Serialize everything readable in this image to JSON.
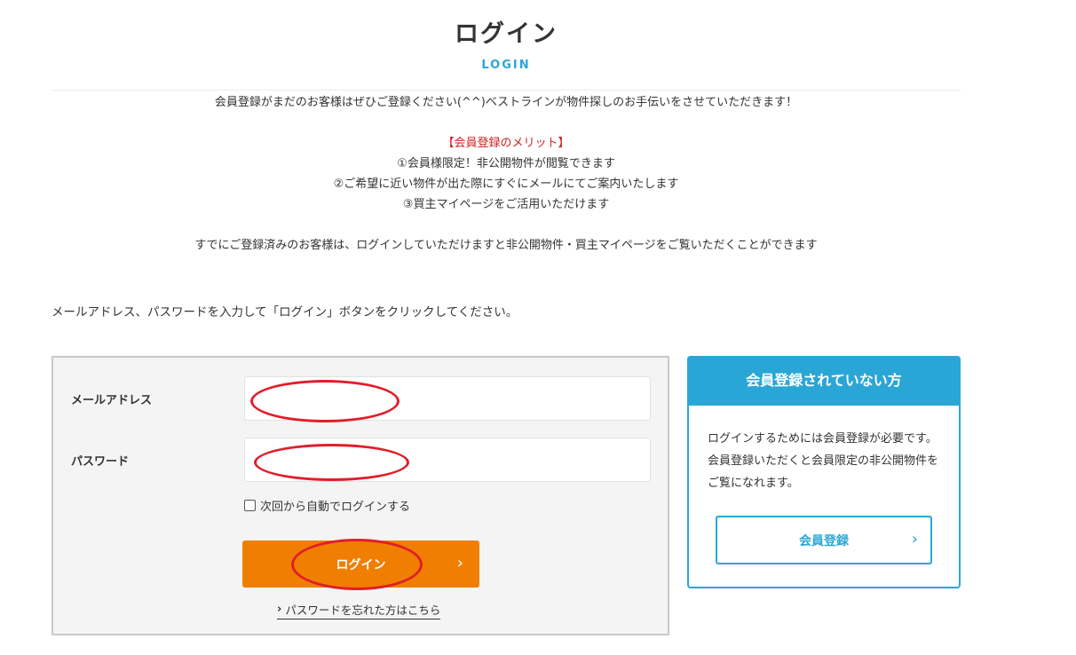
{
  "header": {
    "title": "ログイン",
    "subtitle": "LOGIN"
  },
  "intro": {
    "line1": "会員登録がまだのお客様はぜひご登録ください(^^)ベストラインが物件探しのお手伝いをさせていただきます！",
    "merit_heading": "【会員登録のメリット】",
    "merit_1": "①会員様限定！非公開物件が閲覧できます",
    "merit_2": "②ご希望に近い物件が出た際にすぐにメールにてご案内いたします",
    "merit_3": "③買主マイページをご活用いただけます",
    "line_registered": "すでにご登録済みのお客様は、ログインしていただけますと非公開物件・買主マイページをご覧いただくことができます"
  },
  "instruction": "メールアドレス、パスワードを入力して「ログイン」ボタンをクリックしてください。",
  "login_form": {
    "email_label": "メールアドレス",
    "email_value": "",
    "password_label": "パスワード",
    "password_value": "",
    "remember_label": "次回から自動でログインする",
    "login_button": "ログイン",
    "login_button_icon": "chevron-right-icon",
    "forgot_link": "パスワードを忘れた方はこちら",
    "annotation_color": "#e01e2a"
  },
  "register_panel": {
    "heading": "会員登録されていない方",
    "body": "ログインするためには会員登録が必要です。会員登録いただくと会員限定の非公開物件をご覧になれます。",
    "button": "会員登録",
    "button_icon": "chevron-right-icon"
  },
  "colors": {
    "accent_blue": "#2aa6d6",
    "login_orange": "#f07e00",
    "merit_red": "#d22020"
  }
}
